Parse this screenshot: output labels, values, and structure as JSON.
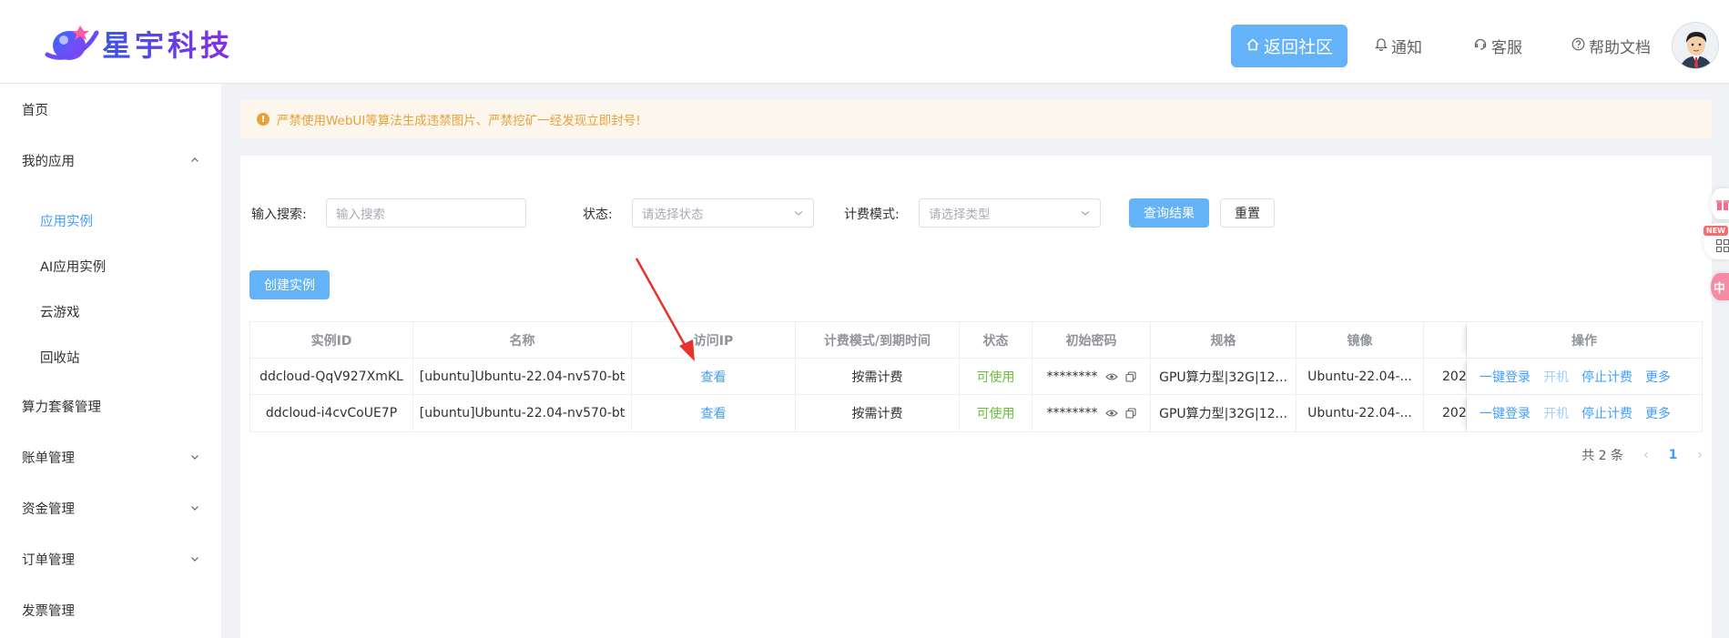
{
  "header": {
    "brand": "星宇科技",
    "nav": [
      {
        "label": "返回社区",
        "icon": "home-icon"
      },
      {
        "label": "通知",
        "icon": "bell-icon"
      },
      {
        "label": "客服",
        "icon": "headset-icon"
      },
      {
        "label": "帮助文档",
        "icon": "question-icon"
      }
    ]
  },
  "sidebar": {
    "items": [
      {
        "label": "首页"
      },
      {
        "label": "我的应用"
      },
      {
        "label": "应用实例"
      },
      {
        "label": "AI应用实例"
      },
      {
        "label": "云游戏"
      },
      {
        "label": "回收站"
      },
      {
        "label": "算力套餐管理"
      },
      {
        "label": "账单管理"
      },
      {
        "label": "资金管理"
      },
      {
        "label": "订单管理"
      },
      {
        "label": "发票管理"
      }
    ]
  },
  "alert": {
    "text": "严禁使用WebUI等算法生成违禁图片、严禁挖矿一经发现立即封号!"
  },
  "filters": {
    "search_label": "输入搜索:",
    "search_placeholder": "输入搜索",
    "status_label": "状态:",
    "status_placeholder": "请选择状态",
    "billing_label": "计费模式:",
    "billing_placeholder": "请选择类型",
    "query_button": "查询结果",
    "reset_button": "重置"
  },
  "create_button": "创建实例",
  "table": {
    "headers": [
      "实例ID",
      "名称",
      "访问IP",
      "计费模式/到期时间",
      "状态",
      "初始密码",
      "规格",
      "镜像",
      "",
      "操作"
    ],
    "rows": [
      {
        "id": "ddcloud-QqV927XmKL",
        "name": "[ubuntu]Ubuntu-22.04-nv570-bt",
        "ip": "查看",
        "billing": "按需计费",
        "status": "可使用",
        "password": "********",
        "spec": "GPU算力型|32G|12...",
        "image": "Ubuntu-22.04-...",
        "extra": "202"
      },
      {
        "id": "ddcloud-i4cvCoUE7P",
        "name": "[ubuntu]Ubuntu-22.04-nv570-bt",
        "ip": "查看",
        "billing": "按需计费",
        "status": "可使用",
        "password": "********",
        "spec": "GPU算力型|32G|12...",
        "image": "Ubuntu-22.04-...",
        "extra": "202"
      }
    ],
    "actions": [
      "一键登录",
      "开机",
      "停止计费",
      "更多"
    ]
  },
  "pagination": {
    "total": "共 2 条",
    "current": "1"
  },
  "floating": {
    "new_badge": "NEW",
    "bottom_label": "中"
  },
  "colors": {
    "primary": "#64b2f7",
    "link": "#409eff",
    "success": "#67c23a",
    "warning": "#e6a23c",
    "arrow": "#e8322b"
  }
}
